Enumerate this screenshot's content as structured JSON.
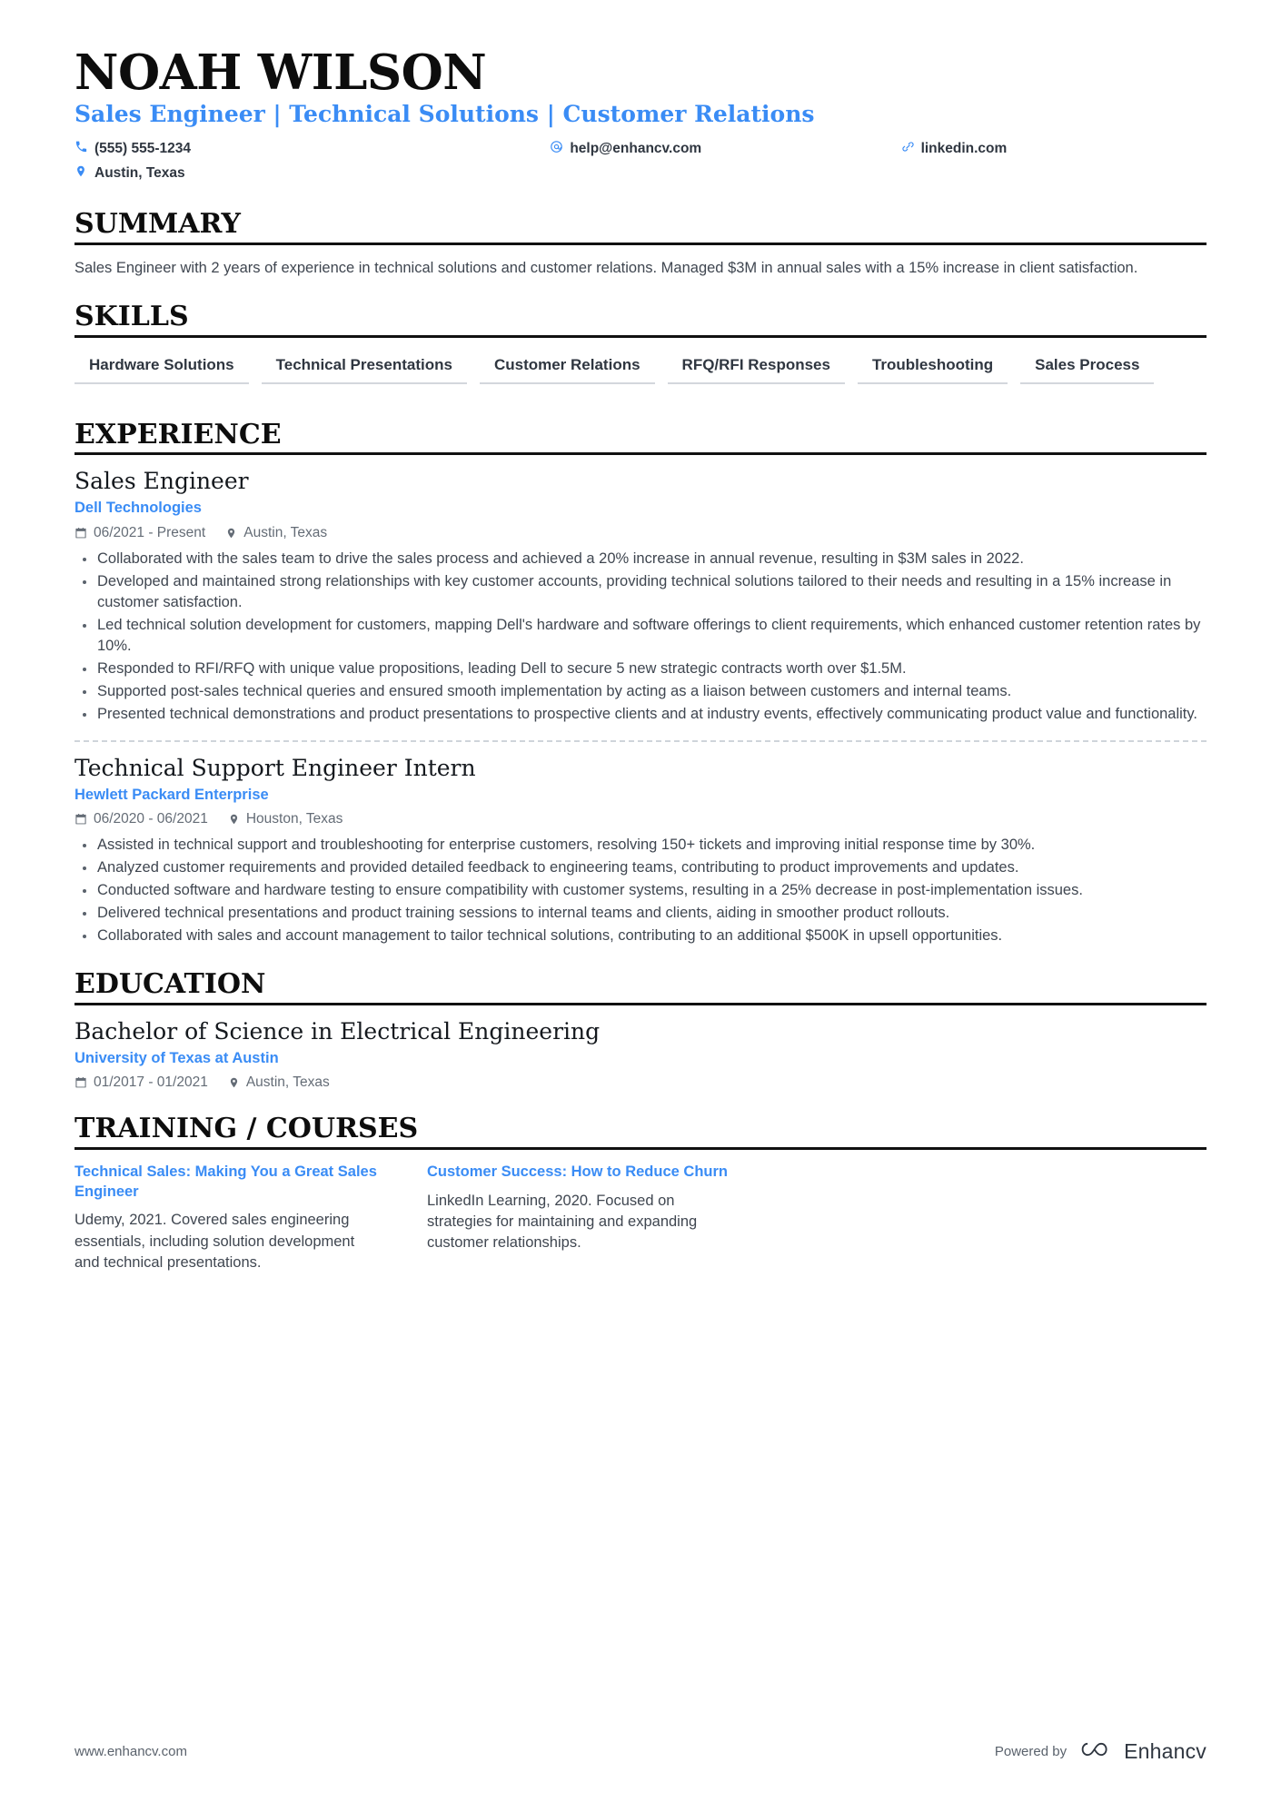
{
  "header": {
    "name": "NOAH WILSON",
    "headline": "Sales Engineer | Technical Solutions | Customer Relations",
    "contacts": [
      {
        "icon": "phone-icon",
        "text": "(555) 555-1234"
      },
      {
        "icon": "email-icon",
        "text": "help@enhancv.com"
      },
      {
        "icon": "link-icon",
        "text": "linkedin.com"
      },
      {
        "icon": "location-icon",
        "text": "Austin, Texas"
      }
    ]
  },
  "summary": {
    "title": "SUMMARY",
    "text": "Sales Engineer with 2 years of experience in technical solutions and customer relations. Managed $3M in annual sales with a 15% increase in client satisfaction."
  },
  "skills": {
    "title": "SKILLS",
    "items": [
      "Hardware Solutions",
      "Technical Presentations",
      "Customer Relations",
      "RFQ/RFI Responses",
      "Troubleshooting",
      "Sales Process"
    ]
  },
  "experience": {
    "title": "EXPERIENCE",
    "entries": [
      {
        "title": "Sales Engineer",
        "org": "Dell Technologies",
        "date": "06/2021 - Present",
        "location": "Austin, Texas",
        "bullets": [
          "Collaborated with the sales team to drive the sales process and achieved a 20% increase in annual revenue, resulting in $3M sales in 2022.",
          "Developed and maintained strong relationships with key customer accounts, providing technical solutions tailored to their needs and resulting in a 15% increase in customer satisfaction.",
          "Led technical solution development for customers, mapping Dell's hardware and software offerings to client requirements, which enhanced customer retention rates by 10%.",
          "Responded to RFI/RFQ with unique value propositions, leading Dell to secure 5 new strategic contracts worth over $1.5M.",
          "Supported post-sales technical queries and ensured smooth implementation by acting as a liaison between customers and internal teams.",
          "Presented technical demonstrations and product presentations to prospective clients and at industry events, effectively communicating product value and functionality."
        ]
      },
      {
        "title": "Technical Support Engineer Intern",
        "org": "Hewlett Packard Enterprise",
        "date": "06/2020 - 06/2021",
        "location": "Houston, Texas",
        "bullets": [
          "Assisted in technical support and troubleshooting for enterprise customers, resolving 150+ tickets and improving initial response time by 30%.",
          "Analyzed customer requirements and provided detailed feedback to engineering teams, contributing to product improvements and updates.",
          "Conducted software and hardware testing to ensure compatibility with customer systems, resulting in a 25% decrease in post-implementation issues.",
          "Delivered technical presentations and product training sessions to internal teams and clients, aiding in smoother product rollouts.",
          "Collaborated with sales and account management to tailor technical solutions, contributing to an additional $500K in upsell opportunities."
        ]
      }
    ]
  },
  "education": {
    "title": "EDUCATION",
    "entries": [
      {
        "title": "Bachelor of Science in Electrical Engineering",
        "org": "University of Texas at Austin",
        "date": "01/2017 - 01/2021",
        "location": "Austin, Texas"
      }
    ]
  },
  "training": {
    "title": "TRAINING / COURSES",
    "courses": [
      {
        "title": "Technical Sales: Making You a Great Sales Engineer",
        "description": "Udemy, 2021. Covered sales engineering essentials, including solution development and technical presentations."
      },
      {
        "title": "Customer Success: How to Reduce Churn",
        "description": "LinkedIn Learning, 2020. Focused on strategies for maintaining and expanding customer relationships."
      }
    ]
  },
  "footer": {
    "url": "www.enhancv.com",
    "powered_by": "Powered by",
    "brand": "Enhancv"
  },
  "colors": {
    "accent": "#3a8cf5",
    "heading": "#0d0d0d",
    "body": "#3f4650",
    "muted": "#646c76",
    "rule": "#111111",
    "skill_underline": "#d3d7dc"
  }
}
